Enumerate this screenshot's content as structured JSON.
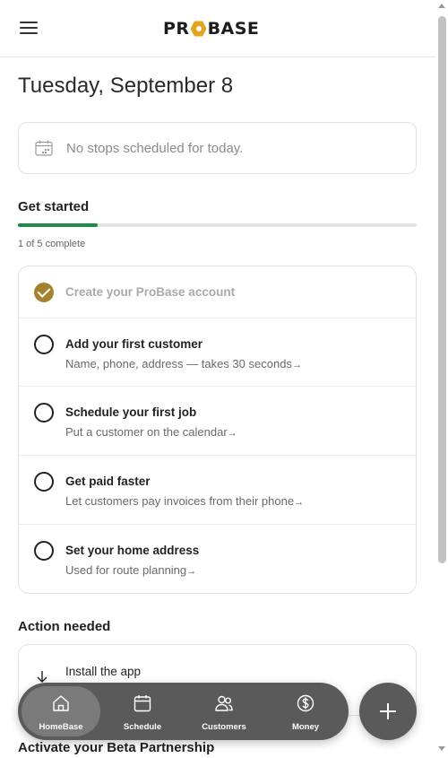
{
  "header": {
    "logo_left": "PR",
    "logo_right": "BASE",
    "menu_icon": "hamburger-menu-icon"
  },
  "date_title": "Tuesday, September 8",
  "schedule": {
    "empty_text": "No stops scheduled for today.",
    "icon": "calendar-icon"
  },
  "get_started": {
    "title": "Get started",
    "progress_text": "1 of 5 complete",
    "progress_fraction": 0.2,
    "progress_color": "#1e8a4c",
    "tasks": [
      {
        "title": "Create your ProBase account",
        "subtitle": "",
        "done": true
      },
      {
        "title": "Add your first customer",
        "subtitle": "Name, phone, address — takes 30 seconds",
        "done": false
      },
      {
        "title": "Schedule your first job",
        "subtitle": "Put a customer on the calendar",
        "done": false
      },
      {
        "title": "Get paid faster",
        "subtitle": "Let customers pay invoices from their phone",
        "done": false
      },
      {
        "title": "Set your home address",
        "subtitle": "Used for route planning",
        "done": false
      }
    ],
    "arrow": "→"
  },
  "action_needed": {
    "title": "Action needed",
    "install_text": "Install the app",
    "icon": "download-icon"
  },
  "beta": {
    "title": "Activate your Beta Partnership"
  },
  "nav": {
    "items": [
      {
        "label": "HomeBase",
        "icon": "home-icon",
        "active": true
      },
      {
        "label": "Schedule",
        "icon": "calendar-icon",
        "active": false
      },
      {
        "label": "Customers",
        "icon": "customers-icon",
        "active": false
      },
      {
        "label": "Money",
        "icon": "dollar-icon",
        "active": false
      }
    ],
    "fab_icon": "plus-icon"
  },
  "colors": {
    "accent_gold": "#a5822f",
    "logo_gold": "#e3a51d",
    "nav_bg": "#5a5a5a"
  }
}
